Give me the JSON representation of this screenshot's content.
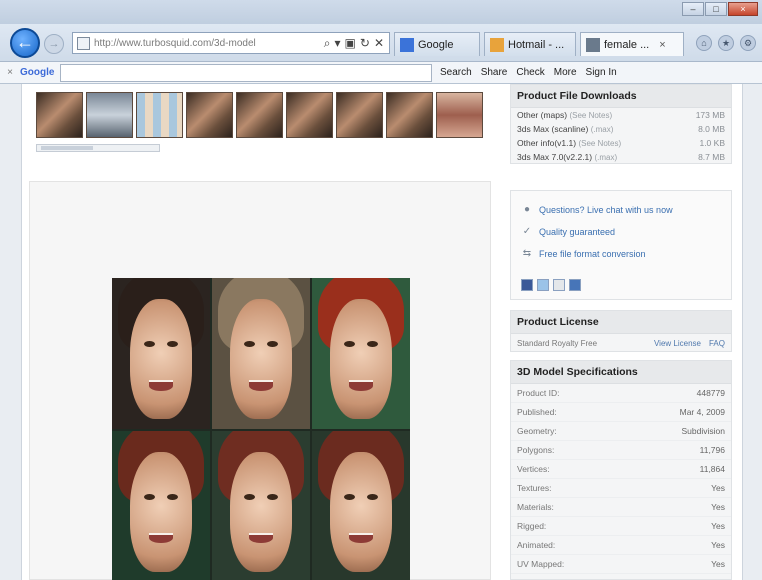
{
  "browser": {
    "url": "http://www.turbosquid.com/3d-model",
    "tabs": [
      {
        "label": "Google",
        "color": "#3b73d9"
      },
      {
        "label": "Hotmail - ...",
        "color": "#e8a33b"
      },
      {
        "label": "female ...",
        "close": "×",
        "color": "#6a7a8c"
      }
    ]
  },
  "google_bar": {
    "logo": "Google",
    "close": "×",
    "tools": [
      "Search",
      "Share",
      "Check",
      "More",
      "Sign In"
    ]
  },
  "downloads": {
    "title": "Product File Downloads",
    "files": [
      {
        "name": "Other (maps)",
        "note": "(See Notes)",
        "size": "173 MB"
      },
      {
        "name": "3ds Max (scanline)",
        "note": "(.max)",
        "size": "8.0 MB"
      },
      {
        "name": "Other info(v1.1)",
        "note": "(See Notes)",
        "size": "1.0 KB"
      },
      {
        "name": "3ds Max 7.0(v2.2.1)",
        "note": "(.max)",
        "size": "8.7 MB"
      }
    ]
  },
  "links": {
    "chat": "Questions? Live chat with us now",
    "quality": "Quality guaranteed",
    "conversion": "Free file format conversion"
  },
  "license": {
    "title": "Product License",
    "name": "Standard Royalty Free",
    "view": "View License",
    "faq": "FAQ"
  },
  "specs": {
    "title": "3D Model Specifications",
    "rows": [
      {
        "label": "Product ID:",
        "value": "448779"
      },
      {
        "label": "Published:",
        "value": "Mar 4, 2009"
      },
      {
        "label": "Geometry:",
        "value": "Subdivision"
      },
      {
        "label": "Polygons:",
        "value": "11,796"
      },
      {
        "label": "Vertices:",
        "value": "11,864"
      },
      {
        "label": "Textures:",
        "value": "Yes"
      },
      {
        "label": "Materials:",
        "value": "Yes"
      },
      {
        "label": "Rigged:",
        "value": "Yes"
      },
      {
        "label": "Animated:",
        "value": "Yes"
      },
      {
        "label": "UV Mapped:",
        "value": "Yes"
      }
    ]
  }
}
